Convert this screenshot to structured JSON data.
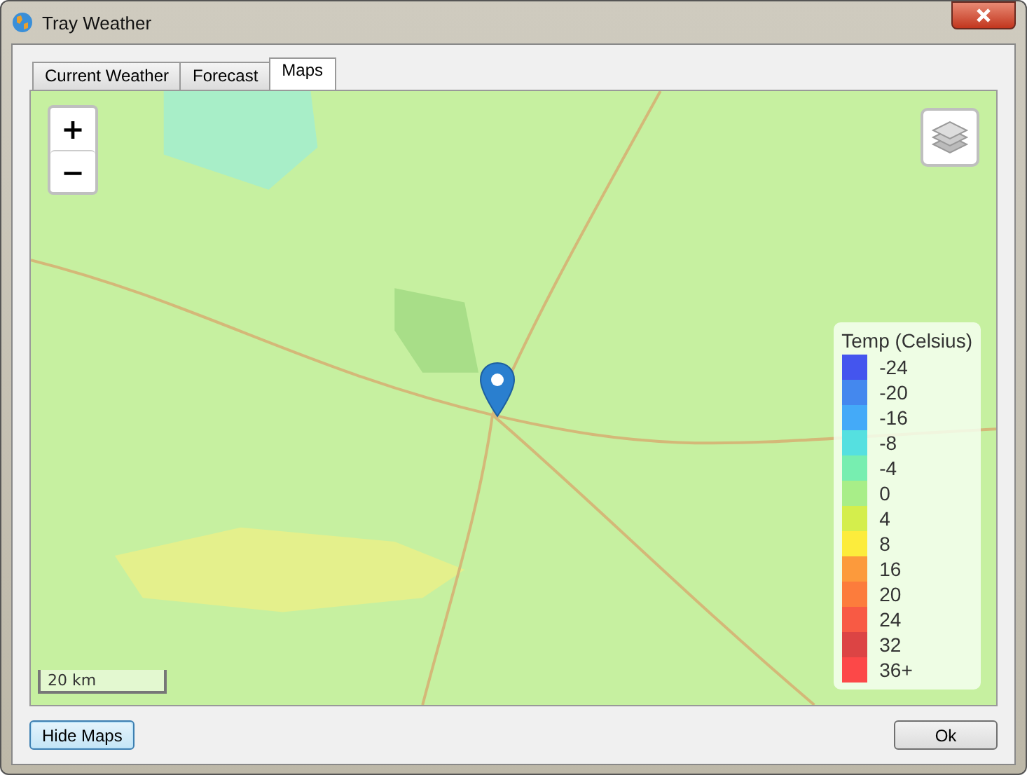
{
  "window": {
    "title": "Tray Weather"
  },
  "tabs": [
    {
      "label": "Current Weather",
      "selected": false
    },
    {
      "label": "Forecast",
      "selected": false
    },
    {
      "label": "Maps",
      "selected": true
    }
  ],
  "map": {
    "zoom_in": "+",
    "zoom_out": "−",
    "scale": "20 km",
    "legend": {
      "title": "Temp (Celsius)",
      "items": [
        {
          "label": "-24",
          "color": "#4455ee"
        },
        {
          "label": "-20",
          "color": "#4488ee"
        },
        {
          "label": "-16",
          "color": "#44aaf8"
        },
        {
          "label": "-8",
          "color": "#55e0e0"
        },
        {
          "label": "-4",
          "color": "#77eeb0"
        },
        {
          "label": "0",
          "color": "#a8ee88"
        },
        {
          "label": "4",
          "color": "#d4ee4c"
        },
        {
          "label": "8",
          "color": "#fcec3c"
        },
        {
          "label": "16",
          "color": "#fc9a3c"
        },
        {
          "label": "20",
          "color": "#fc7c3c"
        },
        {
          "label": "24",
          "color": "#f85a44"
        },
        {
          "label": "32",
          "color": "#dc4444"
        },
        {
          "label": "36+",
          "color": "#fc4848"
        }
      ]
    }
  },
  "buttons": [
    {
      "label": "Hide Maps",
      "kind": "focused"
    },
    {
      "label": "Ok",
      "kind": "plain"
    }
  ]
}
